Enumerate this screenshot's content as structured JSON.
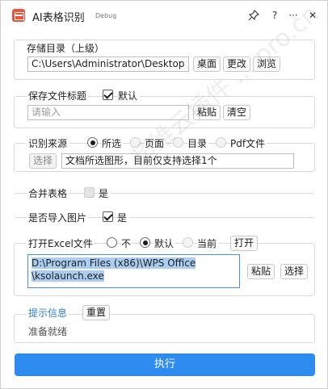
{
  "titlebar": {
    "title": "AI表格识别",
    "badge": "Debug",
    "pin_icon": "pin-icon",
    "help_label": "?",
    "more_label": "···",
    "close_label": "✕"
  },
  "storage": {
    "label": "存储目录（上级）",
    "path_value": "C:\\Users\\Administrator\\Desktop",
    "desktop_button": "桌面",
    "change_button": "更改",
    "browse_button": "浏览"
  },
  "save_title": {
    "label": "保存文件标题",
    "default_label": "默认",
    "default_checked": true,
    "input_placeholder": "请输入",
    "paste_button": "粘贴",
    "clear_button": "清空"
  },
  "source": {
    "label": "识别来源",
    "options": [
      "所选",
      "页面",
      "目录",
      "Pdf文件"
    ],
    "selected": "所选",
    "select_button": "选择",
    "hint_value": "文档所选图形，目前仅支持选择1个"
  },
  "merge": {
    "label": "合并表格",
    "checkbox_label": "是",
    "checked": false
  },
  "import_image": {
    "label": "是否导入图片",
    "checkbox_label": "是",
    "checked": true
  },
  "open_excel": {
    "label": "打开Excel文件",
    "options": [
      "不",
      "默认",
      "当前"
    ],
    "selected": "默认",
    "open_button": "打开",
    "path_line1": "D:\\Program Files (x86)\\WPS Office",
    "path_line2": "\\ksolaunch.exe",
    "paste_button": "粘贴",
    "select_button": "选择"
  },
  "info": {
    "title": "提示信息",
    "reset_button": "重置",
    "status": "准备就绪"
  },
  "run_button": "执行",
  "watermark": "超维云插件 ... pro.cn",
  "colors": {
    "accent": "#2e8cf0",
    "info_title": "#2f7fd6",
    "selection": "#aacdf2"
  }
}
